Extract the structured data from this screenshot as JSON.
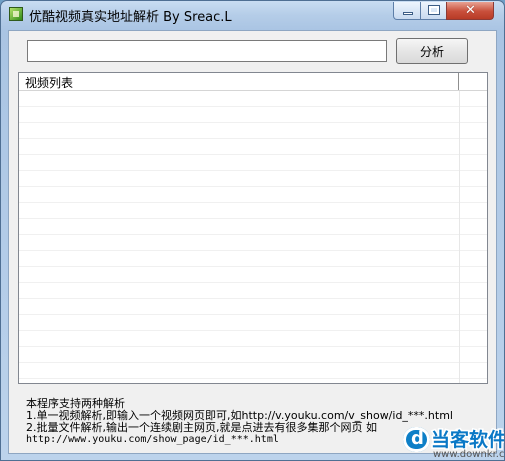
{
  "window": {
    "title": "优酷视频真实地址解析 By Sreac.L",
    "buttons": {
      "minimize_icon": "minimize-icon",
      "maximize_icon": "maximize-icon",
      "close_icon": "close-icon",
      "close_label": "✕"
    }
  },
  "toolbar": {
    "url_value": "",
    "analyze_label": "分析"
  },
  "list": {
    "header": "视频列表",
    "rows": []
  },
  "info": {
    "line1": "本程序支持两种解析",
    "line2": "1.单一视频解析,即输入一个视频网页即可,如http://v.youku.com/v_show/id_***.html",
    "line3": "2.批量文件解析,输出一个连续剧主网页,就是点进去有很多集那个网页 如",
    "line4": "http://www.youku.com/show_page/id_***.html"
  },
  "watermark": {
    "text": "当客软件园",
    "url": "www.downkr.com",
    "logo": "d"
  },
  "colors": {
    "title_bg": "#b5cde8",
    "close_red": "#c84f3b",
    "watermark_blue": "#0a78c6"
  }
}
